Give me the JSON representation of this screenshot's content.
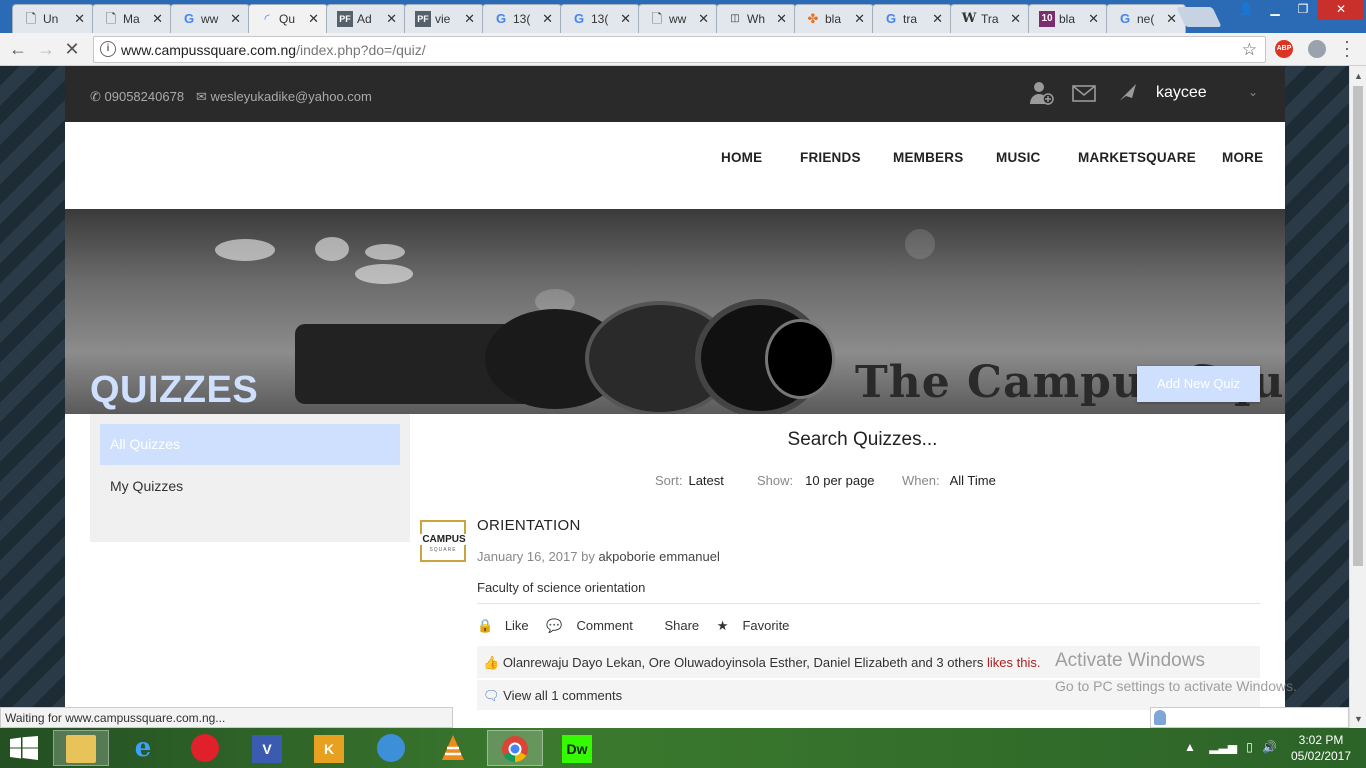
{
  "browser": {
    "tabs": [
      {
        "icon": "document-icon",
        "title": "Un"
      },
      {
        "icon": "document-icon",
        "title": "Ma"
      },
      {
        "icon": "google-icon",
        "title": "ww"
      },
      {
        "icon": "loading-icon",
        "title": "Qu",
        "active": true
      },
      {
        "icon": "pf-icon",
        "title": "Ad"
      },
      {
        "icon": "pf-icon",
        "title": "vie"
      },
      {
        "icon": "google-icon",
        "title": "13("
      },
      {
        "icon": "google-icon",
        "title": "13("
      },
      {
        "icon": "document-icon",
        "title": "ww"
      },
      {
        "icon": "wa-icon",
        "title": "Wh"
      },
      {
        "icon": "pinwheel-icon",
        "title": "bla"
      },
      {
        "icon": "google-icon",
        "title": "tra"
      },
      {
        "icon": "wikipedia-icon",
        "title": "Tra"
      },
      {
        "icon": "ten-icon",
        "title": "bla"
      },
      {
        "icon": "google-icon",
        "title": "ne("
      }
    ],
    "url_host": "www.campussquare.com.ng",
    "url_path": "/index.php?do=/quiz/",
    "abp_label": "ABP",
    "status_text": "Waiting for www.campussquare.com.ng..."
  },
  "site": {
    "phone": "09058240678",
    "email": "wesleyukadike@yahoo.com",
    "username": "kaycee",
    "nav": [
      "HOME",
      "FRIENDS",
      "MEMBERS",
      "MUSIC",
      "MARKETSQUARE",
      "MORE"
    ],
    "hero_brand": "The Campus Square",
    "page_title": "QUIZZES",
    "add_button": "Add New Quiz",
    "sidebar": [
      "All Quizzes",
      "My Quizzes"
    ],
    "search_title": "Search Quizzes...",
    "sort": {
      "label": "Sort:",
      "value": "Latest"
    },
    "show": {
      "label": "Show:",
      "value": "10 per page"
    },
    "when": {
      "label": "When:",
      "value": "All Time"
    },
    "quiz": {
      "logo_line1": "CAMPUS",
      "logo_line2": "SQUARE",
      "title": "ORIENTATION",
      "date": "January 16, 2017",
      "by": "by",
      "author": "akpoborie emmanuel",
      "description": "Faculty of science orientation",
      "actions": {
        "like": "Like",
        "comment": "Comment",
        "share": "Share",
        "favorite": "Favorite"
      },
      "likes_names": "Olanrewaju Dayo Lekan, Ore Oluwadoyinsola Esther, Daniel Elizabeth and 3 others",
      "likes_suffix": "likes this.",
      "comments_link": "View all 1 comments"
    }
  },
  "watermark": {
    "line1": "Activate Windows",
    "line2": "Go to PC settings to activate Windows."
  },
  "taskbar": {
    "apps": [
      "file-explorer-icon",
      "internet-explorer-icon",
      "opera-icon",
      "visio-icon",
      "kmplayer-icon",
      "idm-icon",
      "vlc-icon",
      "chrome-icon",
      "dreamweaver-icon"
    ],
    "visio_label": "V",
    "kmp_label": "K",
    "dw_label": "Dw",
    "time": "3:02 PM",
    "date": "05/02/2017"
  },
  "colors": {
    "accent": "#cfe0ff",
    "topbar": "#2a2a2a",
    "like_red": "#b02020"
  }
}
